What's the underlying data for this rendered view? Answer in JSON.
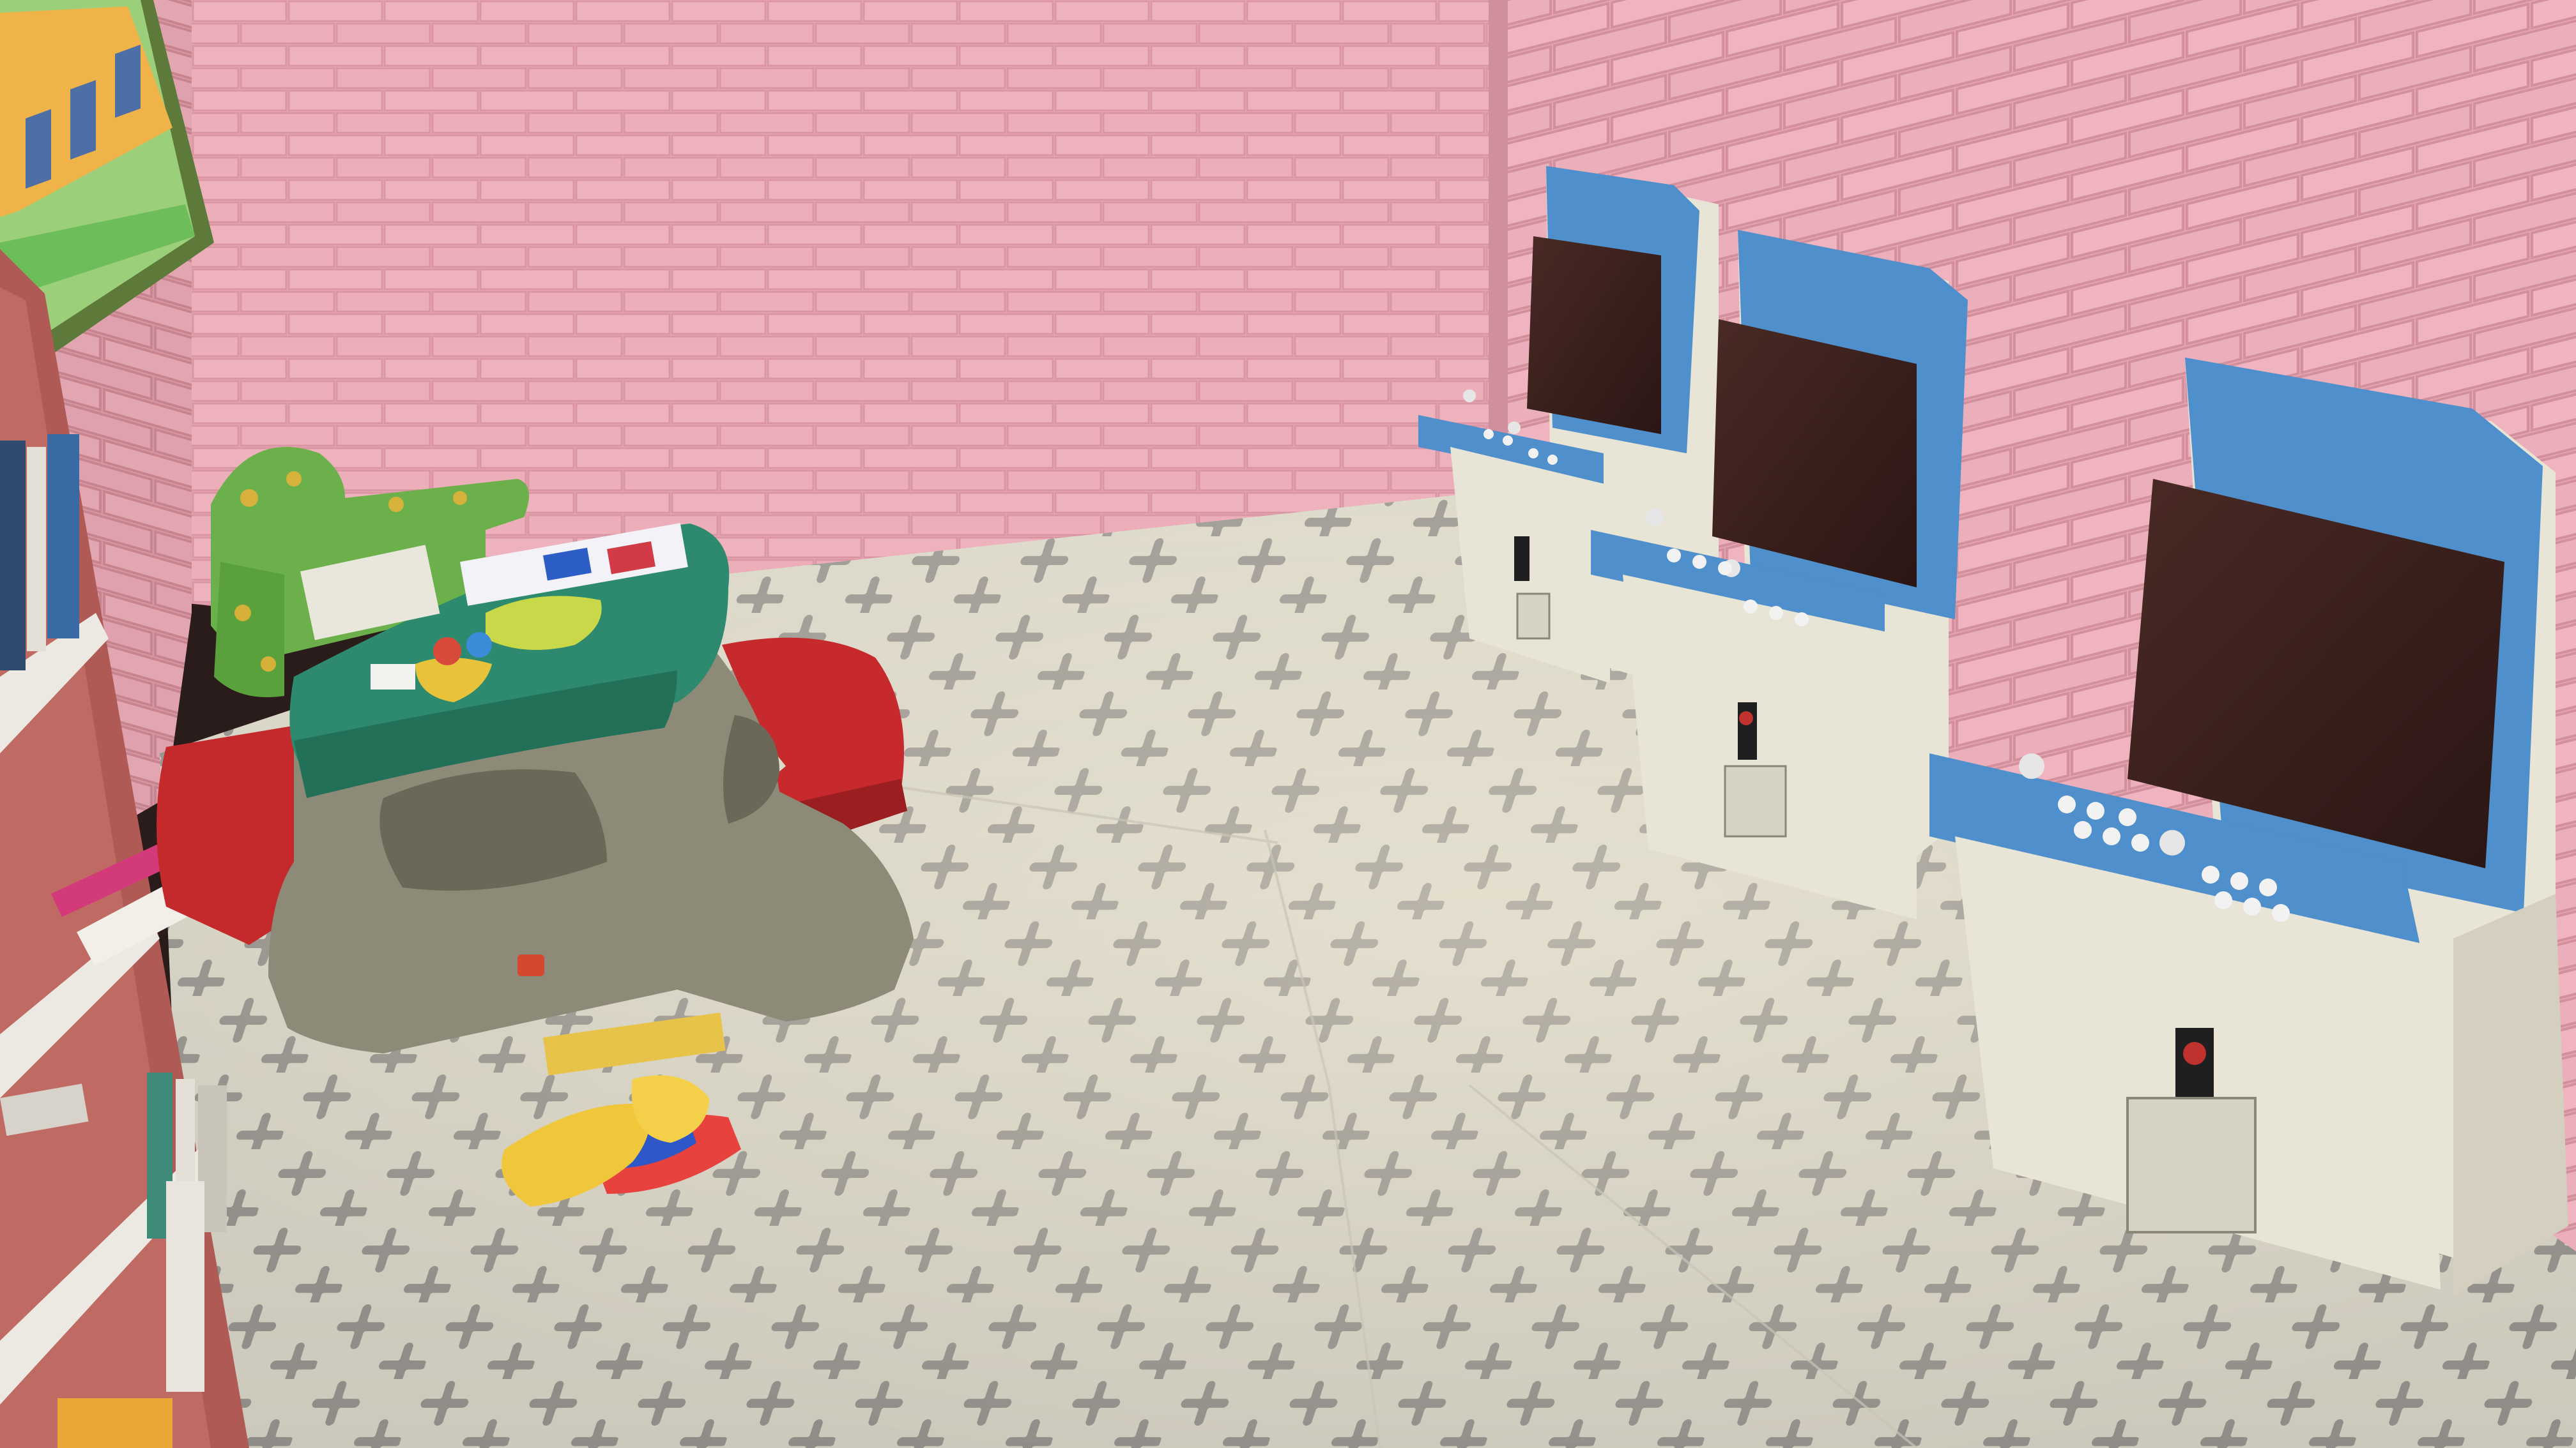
{
  "scene": {
    "description_tag": "",
    "colors": {
      "brick_wall": "#e9aab6",
      "mortar": "#d48f9c",
      "floor_light": "#e6e2d4",
      "floor_pattern": "#9f9b96",
      "cabinet_blue": "#4f8fcb",
      "cabinet_body": "#e8e4d6",
      "screen": "#3a1f1c",
      "table_green": "#2e8a6f",
      "table_body": "#8e8a78",
      "bench_red": "#c4292b",
      "shelf_red": "#b45a55",
      "sofa_green": "#6bb04a",
      "toy_yellow": "#f0c63b"
    },
    "objects": [
      {
        "name": "arcade-cabinet",
        "count": 3
      },
      {
        "name": "picnic-table",
        "count": 1
      },
      {
        "name": "kids-armchair",
        "count": 1
      },
      {
        "name": "bookshelf",
        "count": 1
      },
      {
        "name": "framed-picture",
        "count": 1
      }
    ]
  }
}
